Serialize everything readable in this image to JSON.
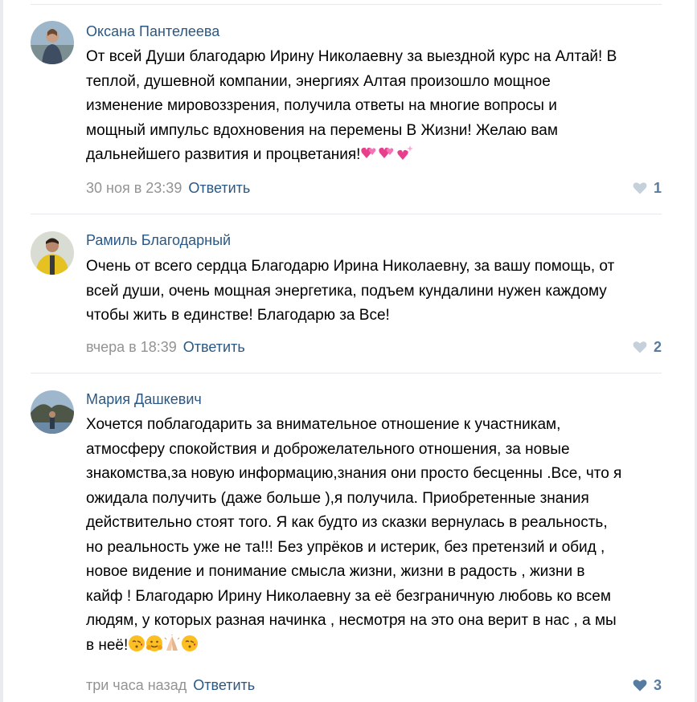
{
  "comments": [
    {
      "author": "Оксана Пантелеева",
      "lines": [
        "От всей Души благодарю Ирину Николаевну за выездной курс на Алтай! В",
        "теплой, душевной компании, энергиях Алтая произошло мощное",
        "изменение мировоззрения, получила ответы на многие вопросы и",
        "мощный импульс вдохновения на перемены В Жизни! Желаю вам",
        "дальнейшего развития и процветания!"
      ],
      "emojis": [
        "two-hearts-icon",
        "two-hearts-icon",
        "sparkling-heart-icon"
      ],
      "time": "30 ноя в 23:39",
      "reply": "Ответить",
      "likes": "1"
    },
    {
      "author": "Рамиль Благодарный",
      "lines": [
        "Очень от всего сердца Благодарю Ирина Николаевну, за вашу помощь, от",
        "всей души, очень мощная энергетика, подъем кундалини нужен каждому",
        "чтобы жить в единстве! Благодарю за Все!"
      ],
      "time": "вчера в 18:39",
      "reply": "Ответить",
      "likes": "2"
    },
    {
      "author": "Мария Дашкевич",
      "lines": [
        "Хочется поблагодарить за внимательное отношение к участникам,",
        "атмосферу спокойствия и доброжелательного отношения, за новые",
        "знакомства,за новую информацию,знания они просто бесценны .Все, что я",
        "ожидала получить (даже больше ),я получила. Приобретенные знания",
        "действительно стоят того. Я как будто из сказки вернулась в реальность,",
        "но реальность уже не та!!! Без упрёков и истерик, без претензий и обид ,",
        " новое видение и понимание смысла жизни, жизни в радость , жизни в",
        "кайф ! Благодарю Ирину Николаевну за её безграничную любовь ко всем",
        "людям, у которых разная начинка , несмотря на это она верит в нас , а мы",
        "в неё!"
      ],
      "emojis": [
        "kissing-face-icon",
        "hugging-face-icon",
        "folded-hands-icon",
        "kissing-face-icon"
      ],
      "time": "три часа назад",
      "reply": "Ответить",
      "likes": "3"
    }
  ],
  "colors": {
    "author": "#2a5885",
    "meta": "#939393",
    "like": "#577ca1",
    "separator": "#e7e8ec"
  }
}
